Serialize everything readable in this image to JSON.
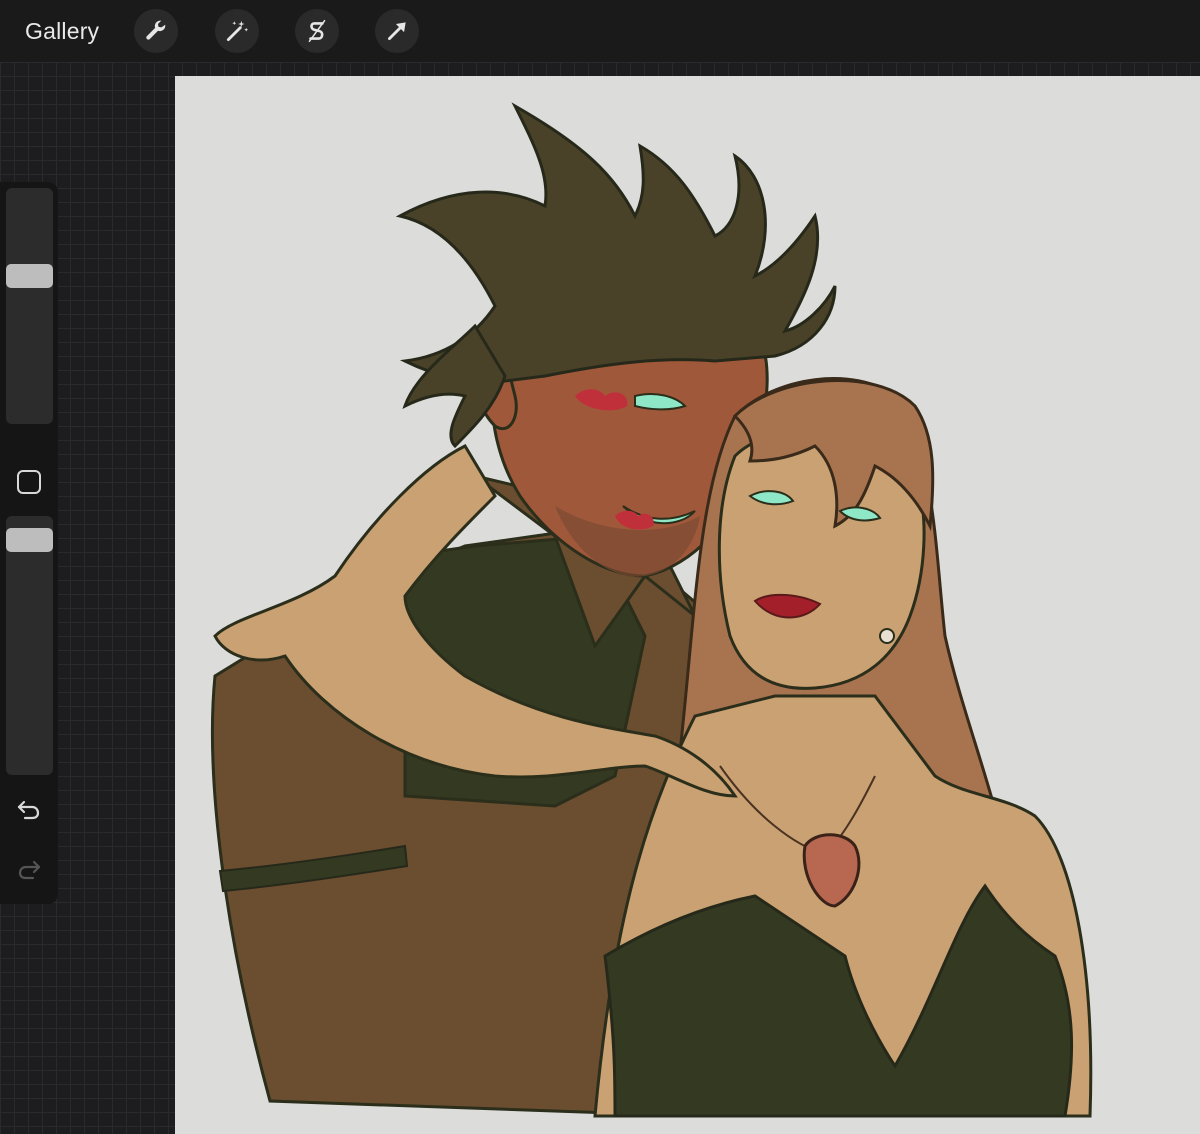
{
  "toolbar": {
    "gallery_label": "Gallery",
    "tools": [
      {
        "icon": "wrench-icon"
      },
      {
        "icon": "magic-wand-icon"
      },
      {
        "icon": "selection-s-icon"
      },
      {
        "icon": "arrow-transform-icon"
      }
    ]
  },
  "sidebar": {
    "brush_size_level": 0.64,
    "opacity_level": 0.95,
    "modify_icon": "square-icon",
    "undo_icon": "undo-arrow-icon",
    "redo_icon": "redo-arrow-icon"
  },
  "colors": {
    "toolbar_bg": "#1a1a1a",
    "canvas_bg": "#dcdcda",
    "hair_dark": "#4a4228",
    "skin_man": "#a0583a",
    "skin_woman": "#c9a172",
    "shirt_brown": "#6b4d30",
    "dress_dark": "#343a22",
    "hair_woman": "#a87450",
    "lips": "#a3202a",
    "eyes": "#8ee8c8"
  }
}
